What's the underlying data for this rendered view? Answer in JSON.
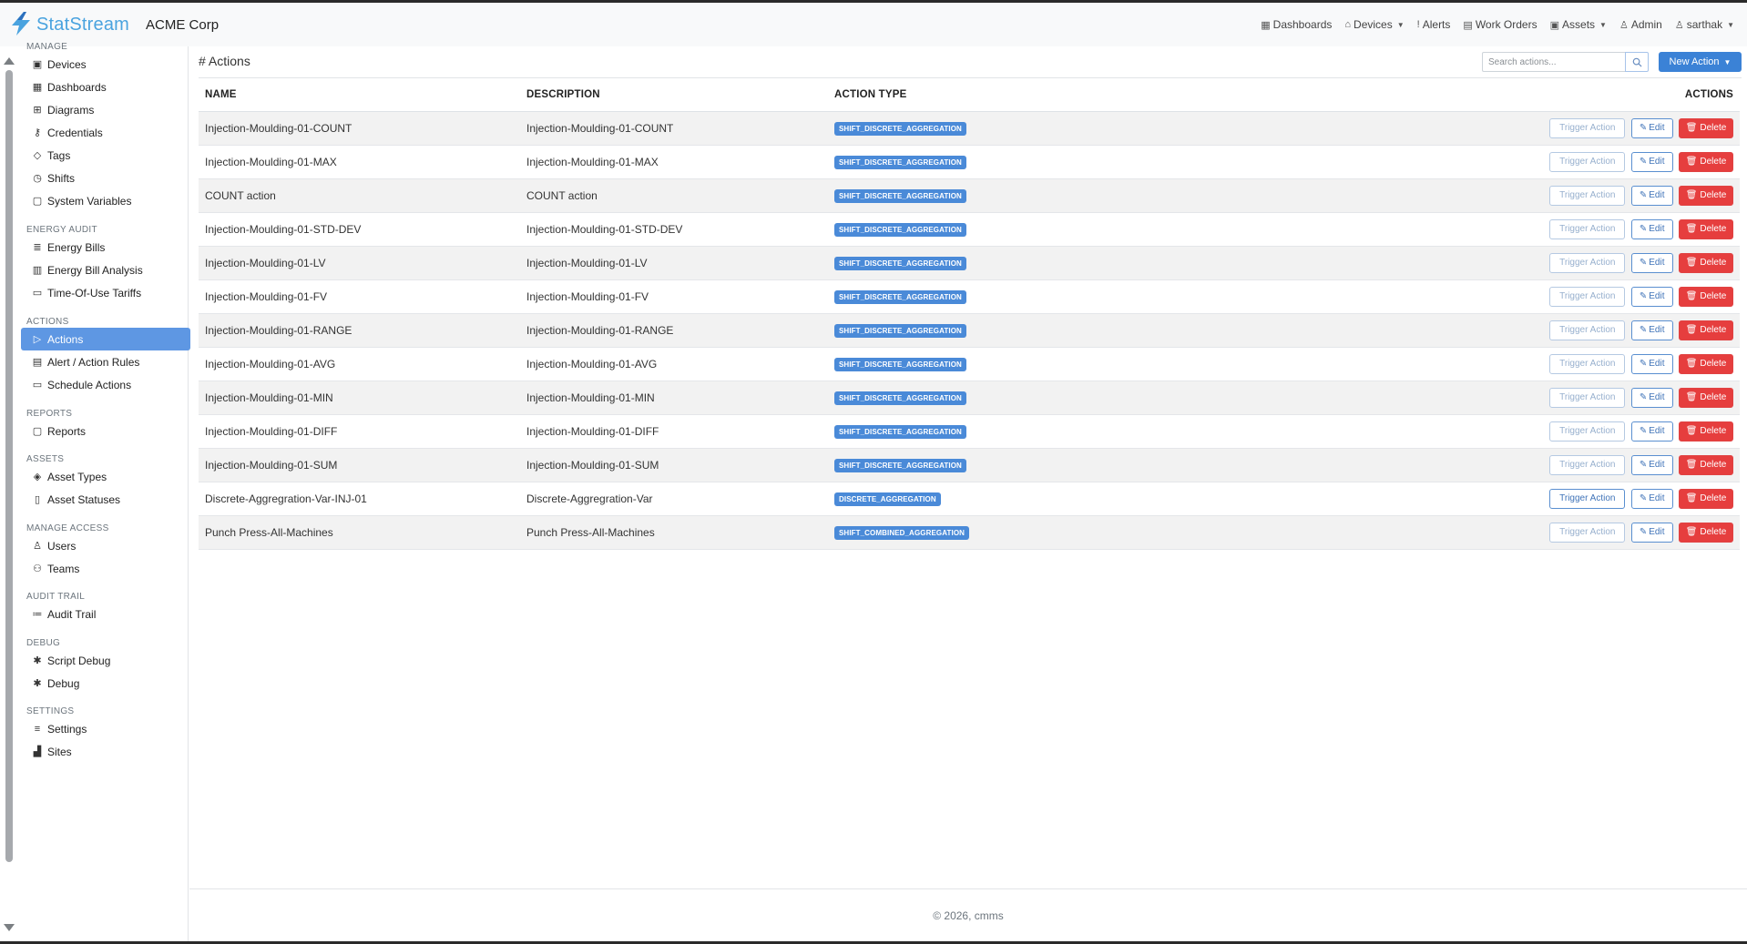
{
  "brand": {
    "name": "StatStream",
    "org": "ACME Corp",
    "accent": "#4aa3df"
  },
  "topnav": [
    {
      "label": "Dashboards",
      "icon": "dashboard-icon",
      "dropdown": false
    },
    {
      "label": "Devices",
      "icon": "device-icon",
      "dropdown": true
    },
    {
      "label": "Alerts",
      "icon": "alert-icon",
      "dropdown": false
    },
    {
      "label": "Work Orders",
      "icon": "clipboard-icon",
      "dropdown": false
    },
    {
      "label": "Assets",
      "icon": "asset-icon",
      "dropdown": true
    },
    {
      "label": "Admin",
      "icon": "admin-icon",
      "dropdown": false
    },
    {
      "label": "sarthak",
      "icon": "user-icon",
      "dropdown": true
    }
  ],
  "sidebar": {
    "sections": [
      {
        "title": "MANAGE",
        "items": [
          {
            "label": "Devices",
            "icon": "devices-icon"
          },
          {
            "label": "Dashboards",
            "icon": "dashboard-icon"
          },
          {
            "label": "Diagrams",
            "icon": "diagram-icon"
          },
          {
            "label": "Credentials",
            "icon": "key-icon"
          },
          {
            "label": "Tags",
            "icon": "tag-icon"
          },
          {
            "label": "Shifts",
            "icon": "clock-icon"
          },
          {
            "label": "System Variables",
            "icon": "variable-icon"
          }
        ]
      },
      {
        "title": "ENERGY AUDIT",
        "items": [
          {
            "label": "Energy Bills",
            "icon": "bill-icon"
          },
          {
            "label": "Energy Bill Analysis",
            "icon": "chart-icon"
          },
          {
            "label": "Time-Of-Use Tariffs",
            "icon": "calendar-icon"
          }
        ]
      },
      {
        "title": "ACTIONS",
        "items": [
          {
            "label": "Actions",
            "icon": "play-icon",
            "active": true
          },
          {
            "label": "Alert / Action Rules",
            "icon": "rules-icon"
          },
          {
            "label": "Schedule Actions",
            "icon": "calendar-icon"
          }
        ]
      },
      {
        "title": "REPORTS",
        "items": [
          {
            "label": "Reports",
            "icon": "report-icon"
          }
        ]
      },
      {
        "title": "ASSETS",
        "items": [
          {
            "label": "Asset Types",
            "icon": "layers-icon"
          },
          {
            "label": "Asset Statuses",
            "icon": "bookmark-icon"
          }
        ]
      },
      {
        "title": "MANAGE ACCESS",
        "items": [
          {
            "label": "Users",
            "icon": "user-icon"
          },
          {
            "label": "Teams",
            "icon": "team-icon"
          }
        ]
      },
      {
        "title": "AUDIT TRAIL",
        "items": [
          {
            "label": "Audit Trail",
            "icon": "list-icon"
          }
        ]
      },
      {
        "title": "DEBUG",
        "items": [
          {
            "label": "Script Debug",
            "icon": "bug-icon"
          },
          {
            "label": "Debug",
            "icon": "bug-icon"
          }
        ]
      },
      {
        "title": "SETTINGS",
        "items": [
          {
            "label": "Settings",
            "icon": "sliders-icon"
          },
          {
            "label": "Sites",
            "icon": "sites-icon"
          }
        ]
      }
    ]
  },
  "main": {
    "title": "# Actions",
    "search_placeholder": "Search actions...",
    "new_action_label": "New Action",
    "columns": [
      "NAME",
      "DESCRIPTION",
      "ACTION TYPE",
      "ACTIONS"
    ],
    "row_buttons": {
      "trigger": "Trigger Action",
      "edit": "Edit",
      "delete": "Delete"
    },
    "rows": [
      {
        "name": "Injection-Moulding-01-COUNT",
        "description": "Injection-Moulding-01-COUNT",
        "type": "SHIFT_DISCRETE_AGGREGATION",
        "trigger_enabled": false
      },
      {
        "name": "Injection-Moulding-01-MAX",
        "description": "Injection-Moulding-01-MAX",
        "type": "SHIFT_DISCRETE_AGGREGATION",
        "trigger_enabled": false
      },
      {
        "name": "COUNT action",
        "description": "COUNT action",
        "type": "SHIFT_DISCRETE_AGGREGATION",
        "trigger_enabled": false
      },
      {
        "name": "Injection-Moulding-01-STD-DEV",
        "description": "Injection-Moulding-01-STD-DEV",
        "type": "SHIFT_DISCRETE_AGGREGATION",
        "trigger_enabled": false
      },
      {
        "name": "Injection-Moulding-01-LV",
        "description": "Injection-Moulding-01-LV",
        "type": "SHIFT_DISCRETE_AGGREGATION",
        "trigger_enabled": false
      },
      {
        "name": "Injection-Moulding-01-FV",
        "description": "Injection-Moulding-01-FV",
        "type": "SHIFT_DISCRETE_AGGREGATION",
        "trigger_enabled": false
      },
      {
        "name": "Injection-Moulding-01-RANGE",
        "description": "Injection-Moulding-01-RANGE",
        "type": "SHIFT_DISCRETE_AGGREGATION",
        "trigger_enabled": false
      },
      {
        "name": "Injection-Moulding-01-AVG",
        "description": "Injection-Moulding-01-AVG",
        "type": "SHIFT_DISCRETE_AGGREGATION",
        "trigger_enabled": false
      },
      {
        "name": "Injection-Moulding-01-MIN",
        "description": "Injection-Moulding-01-MIN",
        "type": "SHIFT_DISCRETE_AGGREGATION",
        "trigger_enabled": false
      },
      {
        "name": "Injection-Moulding-01-DIFF",
        "description": "Injection-Moulding-01-DIFF",
        "type": "SHIFT_DISCRETE_AGGREGATION",
        "trigger_enabled": false
      },
      {
        "name": "Injection-Moulding-01-SUM",
        "description": "Injection-Moulding-01-SUM",
        "type": "SHIFT_DISCRETE_AGGREGATION",
        "trigger_enabled": false
      },
      {
        "name": "Discrete-Aggregration-Var-INJ-01",
        "description": "Discrete-Aggregration-Var",
        "type": "DISCRETE_AGGREGATION",
        "trigger_enabled": true
      },
      {
        "name": "Punch Press-All-Machines",
        "description": "Punch Press-All-Machines",
        "type": "SHIFT_COMBINED_AGGREGATION",
        "trigger_enabled": false
      }
    ]
  },
  "footer": {
    "text": "© 2026, cmms"
  },
  "colors": {
    "primary": "#3b82d6",
    "danger": "#e63e3e",
    "sidebar_active": "#5e97e3",
    "badge": "#4a8ad8"
  }
}
